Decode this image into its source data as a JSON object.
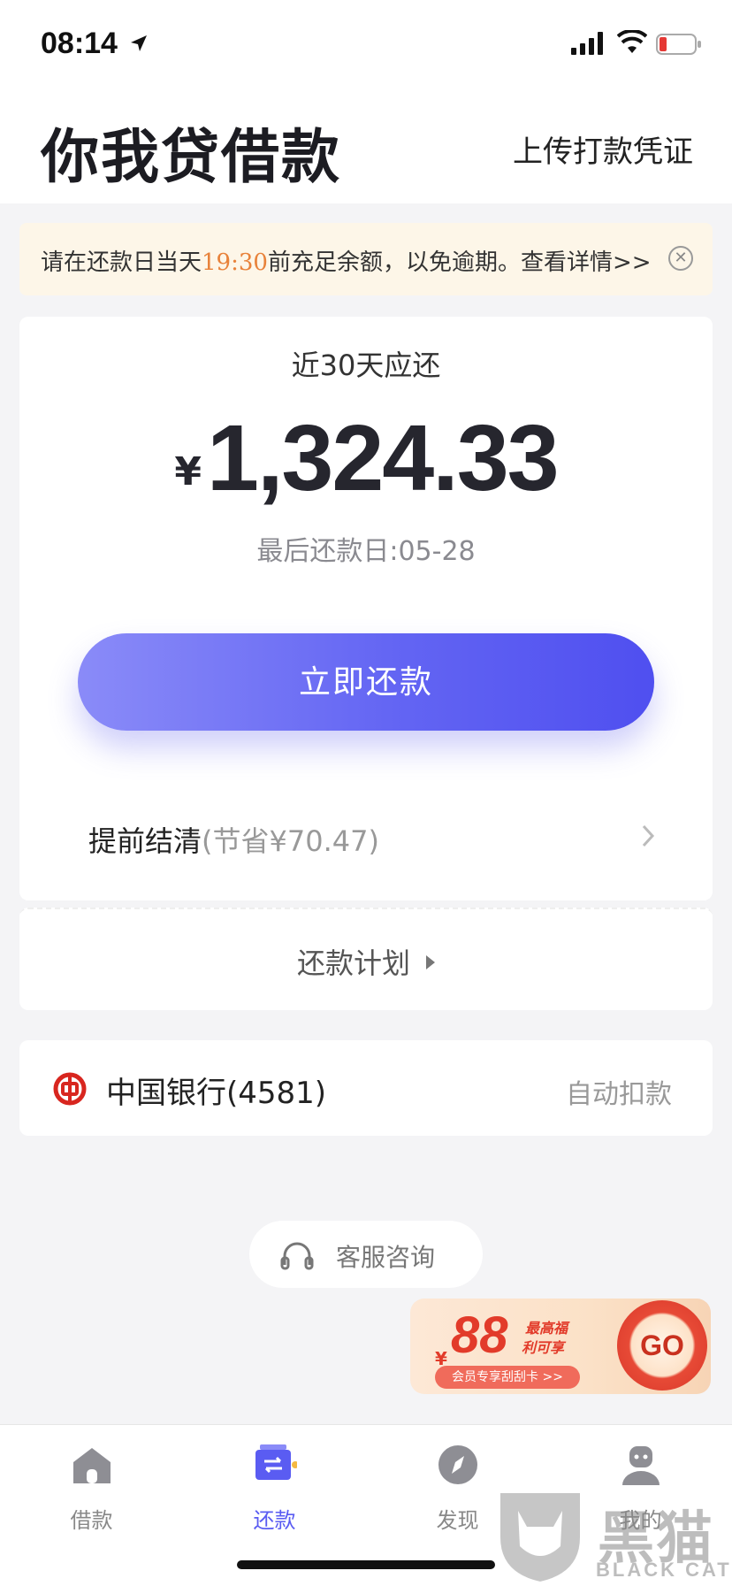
{
  "status_bar": {
    "time": "08:14"
  },
  "header": {
    "title": "你我贷借款",
    "upload_link": "上传打款凭证"
  },
  "notice": {
    "text_before": "请在还款日当天",
    "time": "19:30",
    "text_after": "前充足余额，以免逾期。查看详情>>",
    "close_symbol": "✕"
  },
  "repayment": {
    "due_label": "近30天应还",
    "currency": "¥",
    "amount": "1,324.33",
    "last_date": "最后还款日:05-28",
    "repay_button": "立即还款",
    "early_label": "提前结清",
    "early_saving": "(节省¥70.47)"
  },
  "plan": {
    "label": "还款计划"
  },
  "bank": {
    "name": "中国银行(4581)",
    "auto_label": "自动扣款",
    "logo_color": "#d8261f"
  },
  "service": {
    "label": "客服咨询"
  },
  "promo": {
    "yen": "¥",
    "number": "88",
    "line1": "最高福",
    "line2": "利可享",
    "pill": "会员专享刮刮卡 >>",
    "go": "GO"
  },
  "tabs": [
    {
      "label": "借款",
      "icon": "house-icon",
      "active": false
    },
    {
      "label": "还款",
      "icon": "repay-card-icon",
      "active": true
    },
    {
      "label": "发现",
      "icon": "compass-icon",
      "active": false
    },
    {
      "label": "我的",
      "icon": "person-icon",
      "active": false
    }
  ],
  "watermark": {
    "text": "黑猫",
    "sub": "BLACK CAT"
  },
  "colors": {
    "accent": "#5a5cf2",
    "notice_bg": "#fdf6e8",
    "notice_time": "#e8823a"
  }
}
